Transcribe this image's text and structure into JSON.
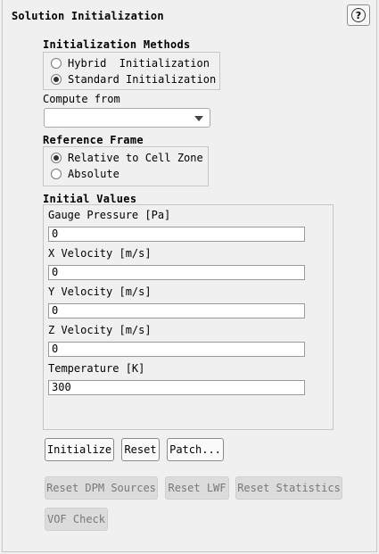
{
  "panel": {
    "title": "Solution Initialization",
    "help_glyph": "?"
  },
  "init_methods": {
    "label": "Initialization Methods",
    "options": [
      {
        "label": "Hybrid  Initialization",
        "checked": false
      },
      {
        "label": "Standard Initialization",
        "checked": true
      }
    ]
  },
  "compute_from": {
    "label": "Compute from",
    "value": ""
  },
  "reference_frame": {
    "label": "Reference Frame",
    "options": [
      {
        "label": "Relative to Cell Zone",
        "checked": true
      },
      {
        "label": "Absolute",
        "checked": false
      }
    ]
  },
  "initial_values": {
    "label": "Initial Values",
    "fields": [
      {
        "label": "Gauge Pressure [Pa]",
        "value": "0"
      },
      {
        "label": "X Velocity [m/s]",
        "value": "0"
      },
      {
        "label": "Y Velocity [m/s]",
        "value": "0"
      },
      {
        "label": "Z Velocity [m/s]",
        "value": "0"
      },
      {
        "label": "Temperature [K]",
        "value": "300"
      }
    ]
  },
  "buttons": {
    "initialize": "Initialize",
    "reset": "Reset",
    "patch": "Patch...",
    "reset_dpm": "Reset DPM Sources",
    "reset_lwf": "Reset LWF",
    "reset_statistics": "Reset Statistics",
    "vof_check": "VOF Check"
  }
}
